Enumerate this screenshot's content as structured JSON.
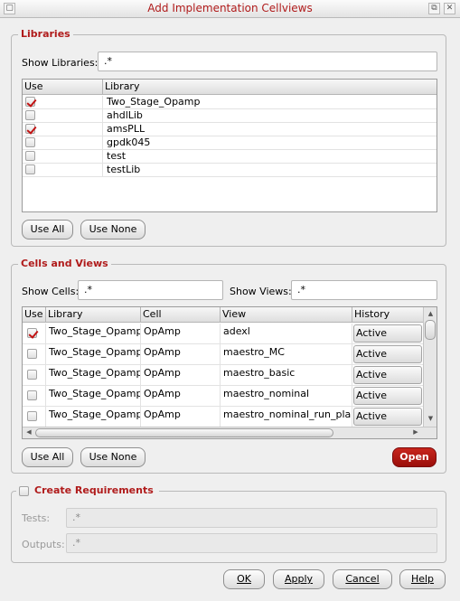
{
  "window": {
    "title": "Add Implementation Cellviews"
  },
  "libraries": {
    "group_title": "Libraries",
    "show_label": "Show Libraries:",
    "show_value": ".*",
    "columns": [
      "Use",
      "Library"
    ],
    "rows": [
      {
        "use": true,
        "library": "Two_Stage_Opamp"
      },
      {
        "use": false,
        "library": "ahdlLib"
      },
      {
        "use": true,
        "library": "amsPLL"
      },
      {
        "use": false,
        "library": "gpdk045"
      },
      {
        "use": false,
        "library": "test"
      },
      {
        "use": false,
        "library": "testLib"
      }
    ],
    "use_all_label": "Use All",
    "use_none_label": "Use None"
  },
  "cells_views": {
    "group_title": "Cells and Views",
    "show_cells_label": "Show Cells:",
    "show_cells_value": ".*",
    "show_views_label": "Show Views:",
    "show_views_value": ".*",
    "columns": [
      "Use",
      "Library",
      "Cell",
      "View",
      "History"
    ],
    "rows": [
      {
        "use": true,
        "library": "Two_Stage_Opamp",
        "cell": "OpAmp",
        "view": "adexl",
        "history": "Active"
      },
      {
        "use": false,
        "library": "Two_Stage_Opamp",
        "cell": "OpAmp",
        "view": "maestro_MC",
        "history": "Active"
      },
      {
        "use": false,
        "library": "Two_Stage_Opamp",
        "cell": "OpAmp",
        "view": "maestro_basic",
        "history": "Active"
      },
      {
        "use": false,
        "library": "Two_Stage_Opamp",
        "cell": "OpAmp",
        "view": "maestro_nominal",
        "history": "Active"
      },
      {
        "use": false,
        "library": "Two_Stage_Opamp",
        "cell": "OpAmp",
        "view": "maestro_nominal_run_plan",
        "history": "Active"
      }
    ],
    "use_all_label": "Use All",
    "use_none_label": "Use None",
    "open_label": "Open"
  },
  "requirements": {
    "group_title": "Create Requirements",
    "checked": false,
    "tests_label": "Tests:",
    "tests_value": ".*",
    "outputs_label": "Outputs:",
    "outputs_value": ".*"
  },
  "footer": {
    "ok_label": "OK",
    "apply_label": "Apply",
    "cancel_label": "Cancel",
    "help_label": "Help"
  },
  "colors": {
    "accent": "#b01b1b",
    "check": "#c21212"
  }
}
